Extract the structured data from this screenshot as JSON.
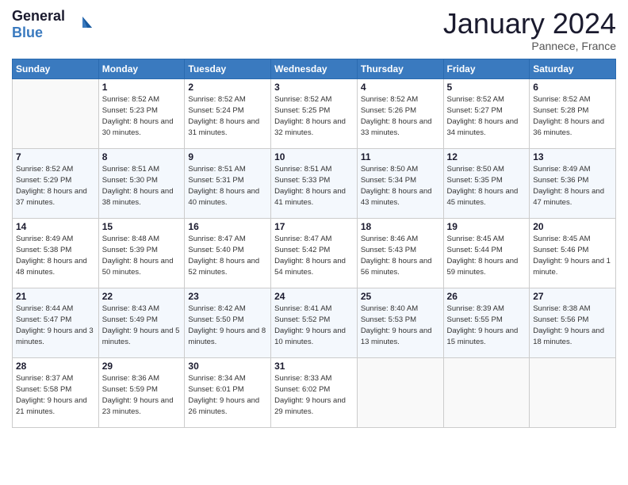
{
  "header": {
    "logo_line1": "General",
    "logo_line2": "Blue",
    "month_title": "January 2024",
    "location": "Pannece, France"
  },
  "weekdays": [
    "Sunday",
    "Monday",
    "Tuesday",
    "Wednesday",
    "Thursday",
    "Friday",
    "Saturday"
  ],
  "weeks": [
    [
      {
        "day": null
      },
      {
        "day": 1,
        "sunrise": "8:52 AM",
        "sunset": "5:23 PM",
        "daylight": "8 hours and 30 minutes."
      },
      {
        "day": 2,
        "sunrise": "8:52 AM",
        "sunset": "5:24 PM",
        "daylight": "8 hours and 31 minutes."
      },
      {
        "day": 3,
        "sunrise": "8:52 AM",
        "sunset": "5:25 PM",
        "daylight": "8 hours and 32 minutes."
      },
      {
        "day": 4,
        "sunrise": "8:52 AM",
        "sunset": "5:26 PM",
        "daylight": "8 hours and 33 minutes."
      },
      {
        "day": 5,
        "sunrise": "8:52 AM",
        "sunset": "5:27 PM",
        "daylight": "8 hours and 34 minutes."
      },
      {
        "day": 6,
        "sunrise": "8:52 AM",
        "sunset": "5:28 PM",
        "daylight": "8 hours and 36 minutes."
      }
    ],
    [
      {
        "day": 7,
        "sunrise": "8:52 AM",
        "sunset": "5:29 PM",
        "daylight": "8 hours and 37 minutes."
      },
      {
        "day": 8,
        "sunrise": "8:51 AM",
        "sunset": "5:30 PM",
        "daylight": "8 hours and 38 minutes."
      },
      {
        "day": 9,
        "sunrise": "8:51 AM",
        "sunset": "5:31 PM",
        "daylight": "8 hours and 40 minutes."
      },
      {
        "day": 10,
        "sunrise": "8:51 AM",
        "sunset": "5:33 PM",
        "daylight": "8 hours and 41 minutes."
      },
      {
        "day": 11,
        "sunrise": "8:50 AM",
        "sunset": "5:34 PM",
        "daylight": "8 hours and 43 minutes."
      },
      {
        "day": 12,
        "sunrise": "8:50 AM",
        "sunset": "5:35 PM",
        "daylight": "8 hours and 45 minutes."
      },
      {
        "day": 13,
        "sunrise": "8:49 AM",
        "sunset": "5:36 PM",
        "daylight": "8 hours and 47 minutes."
      }
    ],
    [
      {
        "day": 14,
        "sunrise": "8:49 AM",
        "sunset": "5:38 PM",
        "daylight": "8 hours and 48 minutes."
      },
      {
        "day": 15,
        "sunrise": "8:48 AM",
        "sunset": "5:39 PM",
        "daylight": "8 hours and 50 minutes."
      },
      {
        "day": 16,
        "sunrise": "8:47 AM",
        "sunset": "5:40 PM",
        "daylight": "8 hours and 52 minutes."
      },
      {
        "day": 17,
        "sunrise": "8:47 AM",
        "sunset": "5:42 PM",
        "daylight": "8 hours and 54 minutes."
      },
      {
        "day": 18,
        "sunrise": "8:46 AM",
        "sunset": "5:43 PM",
        "daylight": "8 hours and 56 minutes."
      },
      {
        "day": 19,
        "sunrise": "8:45 AM",
        "sunset": "5:44 PM",
        "daylight": "8 hours and 59 minutes."
      },
      {
        "day": 20,
        "sunrise": "8:45 AM",
        "sunset": "5:46 PM",
        "daylight": "9 hours and 1 minute."
      }
    ],
    [
      {
        "day": 21,
        "sunrise": "8:44 AM",
        "sunset": "5:47 PM",
        "daylight": "9 hours and 3 minutes."
      },
      {
        "day": 22,
        "sunrise": "8:43 AM",
        "sunset": "5:49 PM",
        "daylight": "9 hours and 5 minutes."
      },
      {
        "day": 23,
        "sunrise": "8:42 AM",
        "sunset": "5:50 PM",
        "daylight": "9 hours and 8 minutes."
      },
      {
        "day": 24,
        "sunrise": "8:41 AM",
        "sunset": "5:52 PM",
        "daylight": "9 hours and 10 minutes."
      },
      {
        "day": 25,
        "sunrise": "8:40 AM",
        "sunset": "5:53 PM",
        "daylight": "9 hours and 13 minutes."
      },
      {
        "day": 26,
        "sunrise": "8:39 AM",
        "sunset": "5:55 PM",
        "daylight": "9 hours and 15 minutes."
      },
      {
        "day": 27,
        "sunrise": "8:38 AM",
        "sunset": "5:56 PM",
        "daylight": "9 hours and 18 minutes."
      }
    ],
    [
      {
        "day": 28,
        "sunrise": "8:37 AM",
        "sunset": "5:58 PM",
        "daylight": "9 hours and 21 minutes."
      },
      {
        "day": 29,
        "sunrise": "8:36 AM",
        "sunset": "5:59 PM",
        "daylight": "9 hours and 23 minutes."
      },
      {
        "day": 30,
        "sunrise": "8:34 AM",
        "sunset": "6:01 PM",
        "daylight": "9 hours and 26 minutes."
      },
      {
        "day": 31,
        "sunrise": "8:33 AM",
        "sunset": "6:02 PM",
        "daylight": "9 hours and 29 minutes."
      },
      {
        "day": null
      },
      {
        "day": null
      },
      {
        "day": null
      }
    ]
  ]
}
